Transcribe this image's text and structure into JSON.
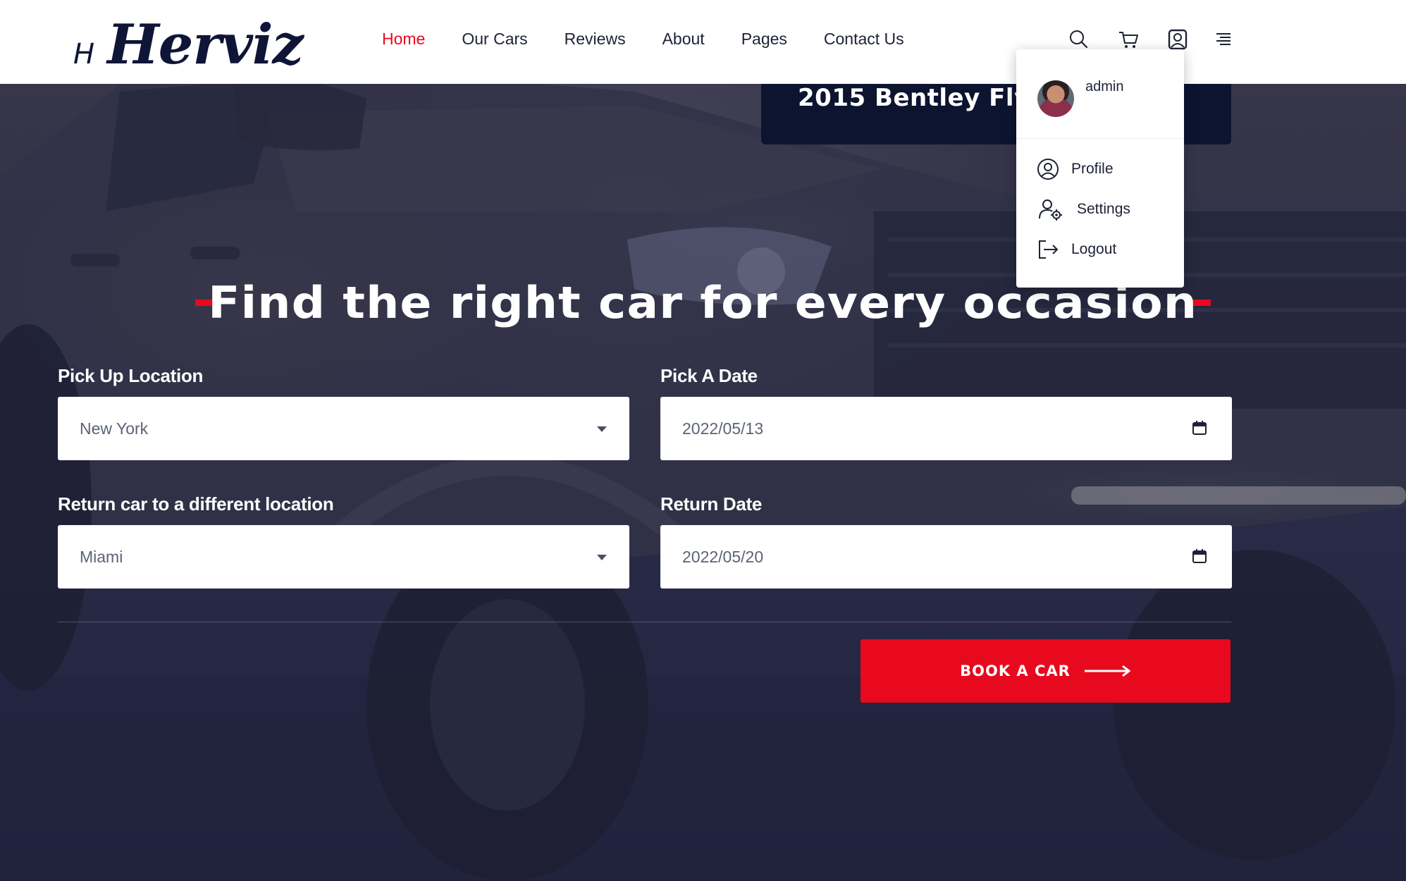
{
  "header": {
    "logo_mark": "H",
    "logo_text": "Herviz",
    "nav": [
      {
        "label": "Home",
        "active": true
      },
      {
        "label": "Our Cars",
        "active": false
      },
      {
        "label": "Reviews",
        "active": false
      },
      {
        "label": "About",
        "active": false
      },
      {
        "label": "Pages",
        "active": false
      },
      {
        "label": "Contact Us",
        "active": false
      }
    ],
    "icons": [
      "search-icon",
      "cart-icon",
      "user-icon",
      "menu-icon"
    ]
  },
  "featured_car": {
    "title": "2015 Bentley Flyi"
  },
  "user_menu": {
    "username": "admin",
    "items": [
      {
        "label": "Profile",
        "icon": "user-circle-icon"
      },
      {
        "label": "Settings",
        "icon": "user-settings-icon"
      },
      {
        "label": "Logout",
        "icon": "logout-icon"
      }
    ]
  },
  "hero": {
    "headline": "Find the right car for every occasion"
  },
  "booking_form": {
    "pickup_location": {
      "label": "Pick Up Location",
      "value": "New York"
    },
    "pickup_date": {
      "label": "Pick A Date",
      "value": "2022/05/13"
    },
    "return_location": {
      "label": "Return car to a different location",
      "value": "Miami"
    },
    "return_date": {
      "label": "Return Date",
      "value": "2022/05/20"
    },
    "submit_label": "BOOK A CAR"
  },
  "colors": {
    "accent": "#e8091e",
    "dark_navy": "#0c1430",
    "text_dark": "#1d2235"
  }
}
